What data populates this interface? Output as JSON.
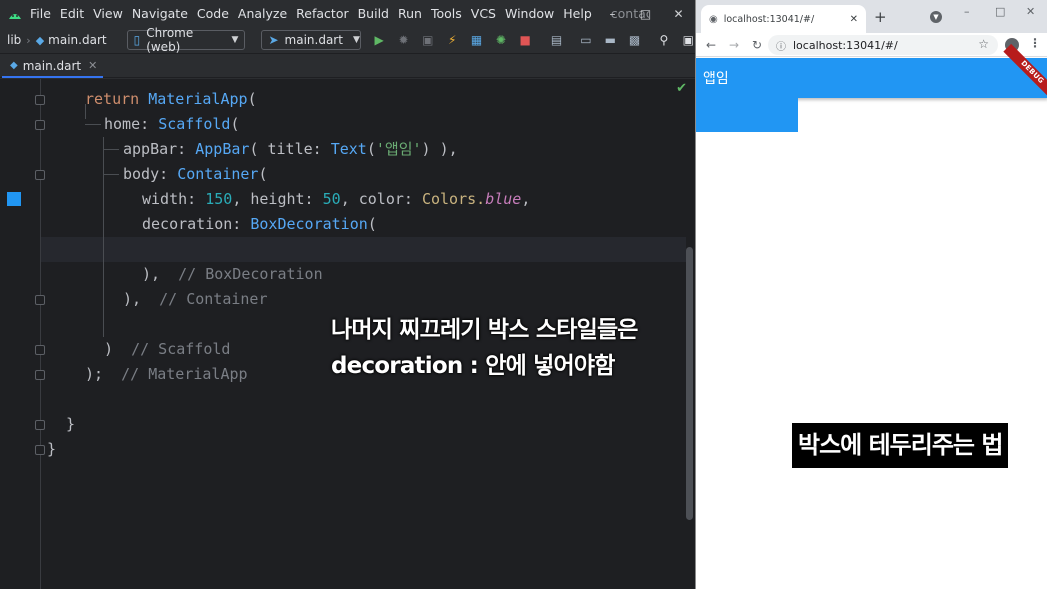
{
  "ide": {
    "menu": [
      "File",
      "Edit",
      "View",
      "Navigate",
      "Code",
      "Analyze",
      "Refactor",
      "Build",
      "Run",
      "Tools",
      "VCS",
      "Window",
      "Help"
    ],
    "project_title": "contac",
    "breadcrumb": {
      "folder": "lib",
      "file": "main.dart"
    },
    "device_select": "Chrome (web)",
    "config_select": "main.dart",
    "tab": "main.dart",
    "code": {
      "l1": {
        "kw": "return",
        "cls": "MaterialApp",
        "tail": "("
      },
      "l2": {
        "prm": "home:",
        "cls": "Scaffold",
        "tail": "("
      },
      "l3": {
        "prm": "appBar:",
        "cls1": "AppBar",
        "mid": "( title: ",
        "cls2": "Text",
        "str": "'앱임'",
        "tail": ") ),"
      },
      "l4": {
        "prm": "body:",
        "cls": "Container",
        "tail": "("
      },
      "l5": {
        "p1": "width: ",
        "n1": "150",
        "p2": ", height: ",
        "n2": "50",
        "p3": ", color: ",
        "c": "Colors.",
        "field": "blue",
        "tail": ","
      },
      "l6": {
        "prm": "decoration:",
        "cls": "BoxDecoration",
        "tail": "("
      },
      "l7": {
        "code": "),",
        "cmt": "// BoxDecoration"
      },
      "l8": {
        "code": "),",
        "cmt": "// Container"
      },
      "l9": {
        "code": ")",
        "cmt": "// Scaffold"
      },
      "l10": {
        "code": ");",
        "cmt": "// MaterialApp"
      },
      "l11": "}",
      "l12": "}"
    },
    "overlay_subtitle": [
      "나머지 찌끄레기 박스 스타일들은",
      "decoration : 안에 넣어야함"
    ]
  },
  "browser": {
    "tab_title": "localhost:13041/#/",
    "url": "localhost:13041/#/",
    "app_title": "앱임",
    "debug_banner": "DEBUG",
    "box_color": "#2196f3",
    "overlay_subtitle": "박스에 테두리주는 법"
  },
  "colors": {
    "flutter_blue": "#2196f3",
    "editor_bg": "#1e1f22",
    "ide_chrome": "#2b2d30"
  }
}
